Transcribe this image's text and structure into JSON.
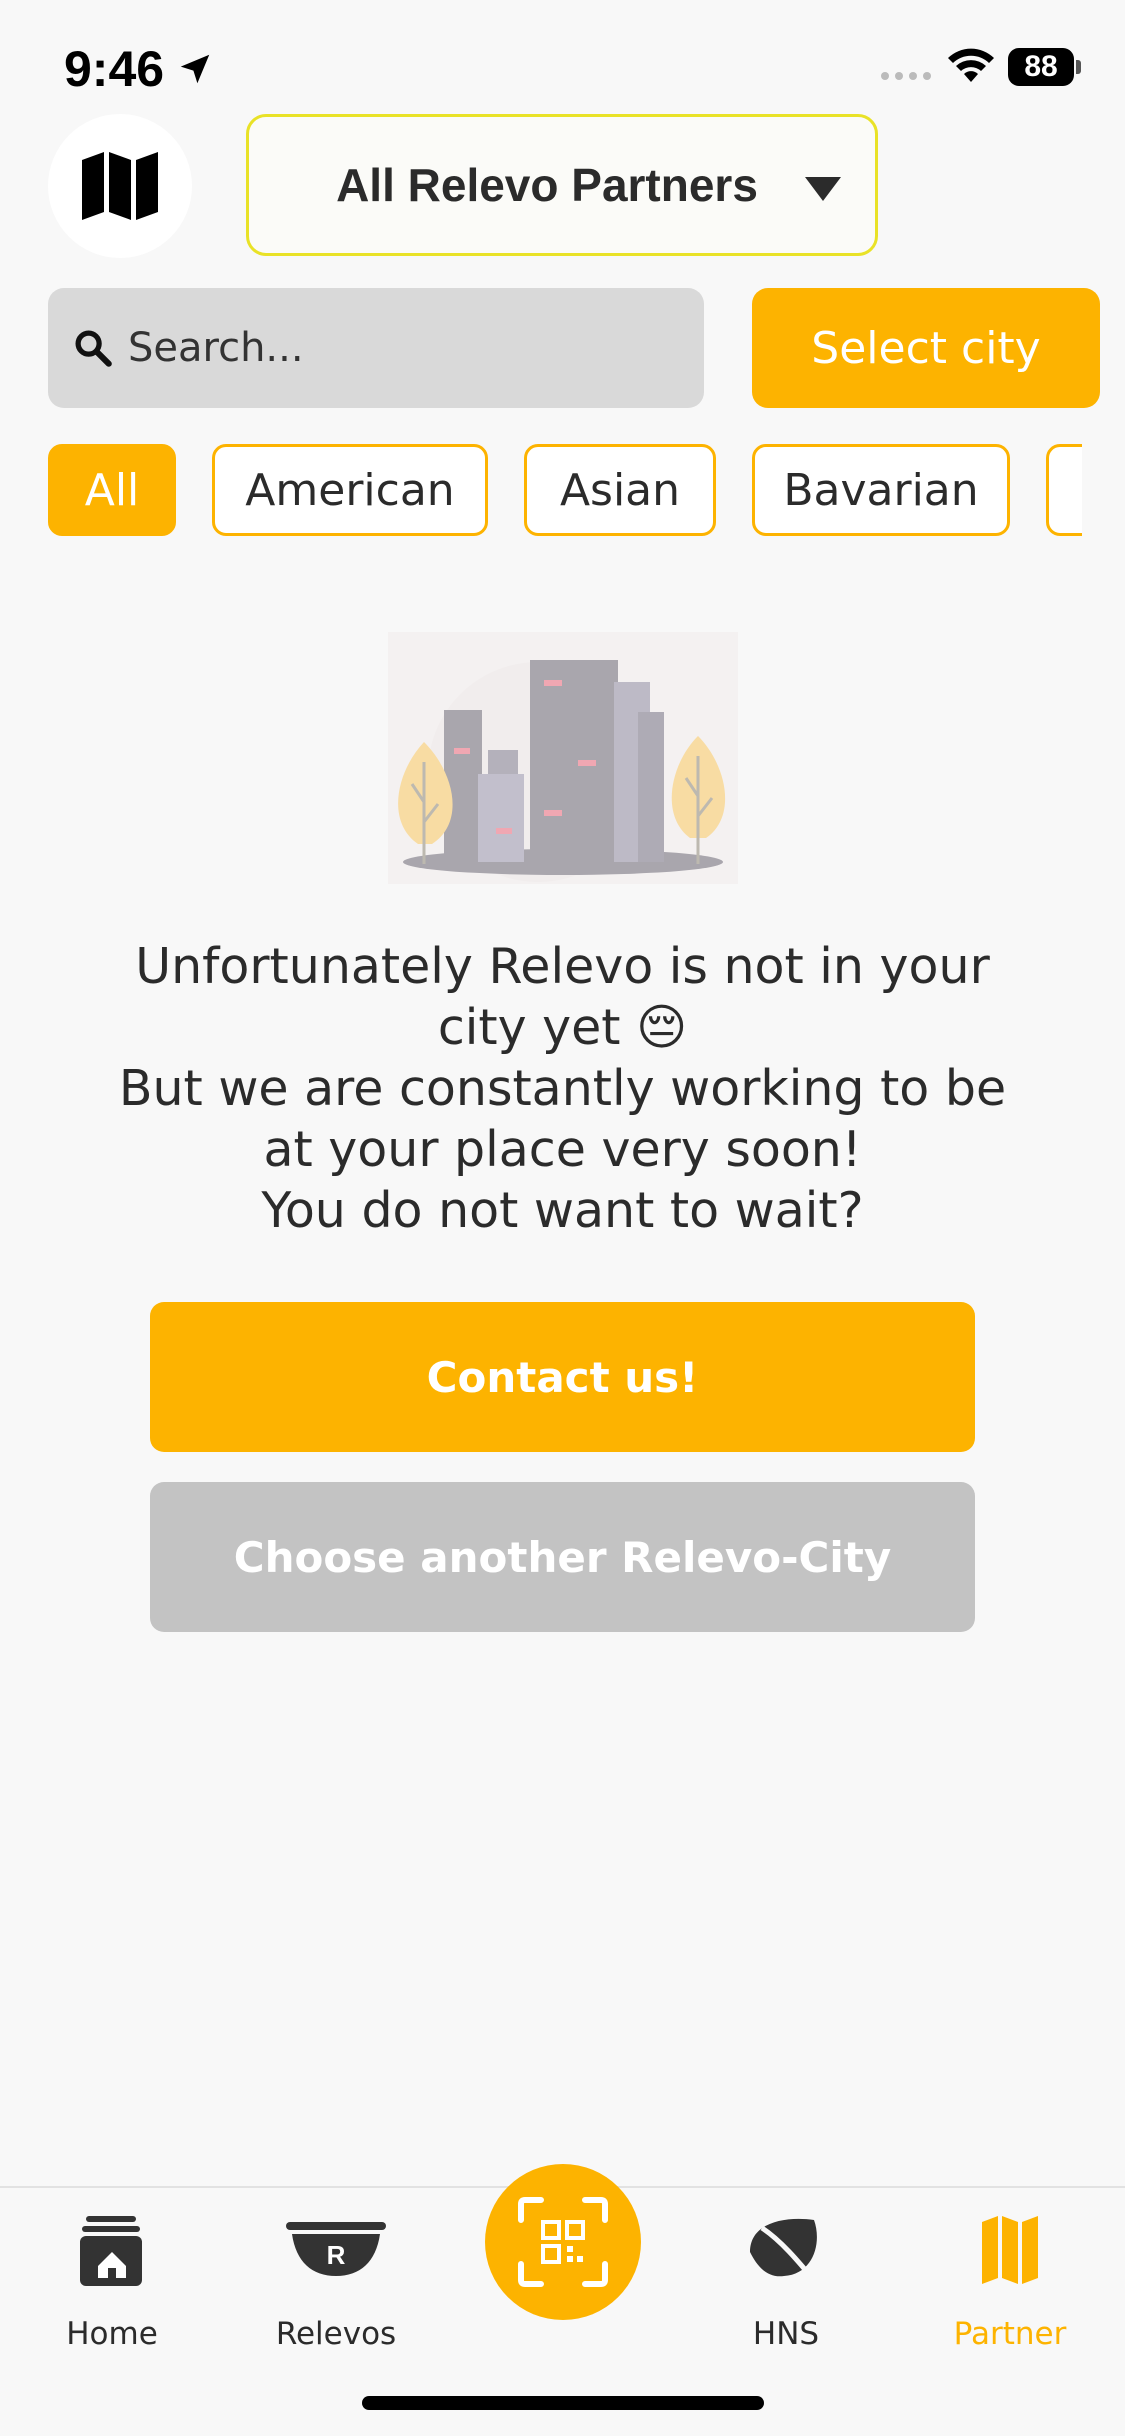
{
  "status_bar": {
    "time": "9:46",
    "battery": "88"
  },
  "header": {
    "map_icon": "map-icon",
    "dropdown_label": "All Relevo Partners"
  },
  "search": {
    "placeholder": "Search...",
    "value": ""
  },
  "select_city_label": "Select city",
  "categories": [
    "All",
    "American",
    "Asian",
    "Bavarian"
  ],
  "active_category": "All",
  "message": {
    "line1": "Unfortunately Relevo is not in your",
    "line2": "city yet 😔",
    "line3": "But we are constantly working to be",
    "line4": "at your place very soon!",
    "line5": "You do not want to wait?"
  },
  "contact_button": "Contact us!",
  "choose_city_button": "Choose another Relevo-City",
  "tabs": [
    {
      "label": "Home",
      "icon": "home-icon"
    },
    {
      "label": "Relevos",
      "icon": "bowl-icon"
    },
    {
      "label": "",
      "icon": "qr-scan-icon"
    },
    {
      "label": "HNS",
      "icon": "leaf-icon"
    },
    {
      "label": "Partner",
      "icon": "map-icon"
    }
  ],
  "active_tab": "Partner",
  "colors": {
    "accent": "#fdb300",
    "dropdown_border": "#e9e227",
    "muted_button": "#c3c3c3"
  }
}
